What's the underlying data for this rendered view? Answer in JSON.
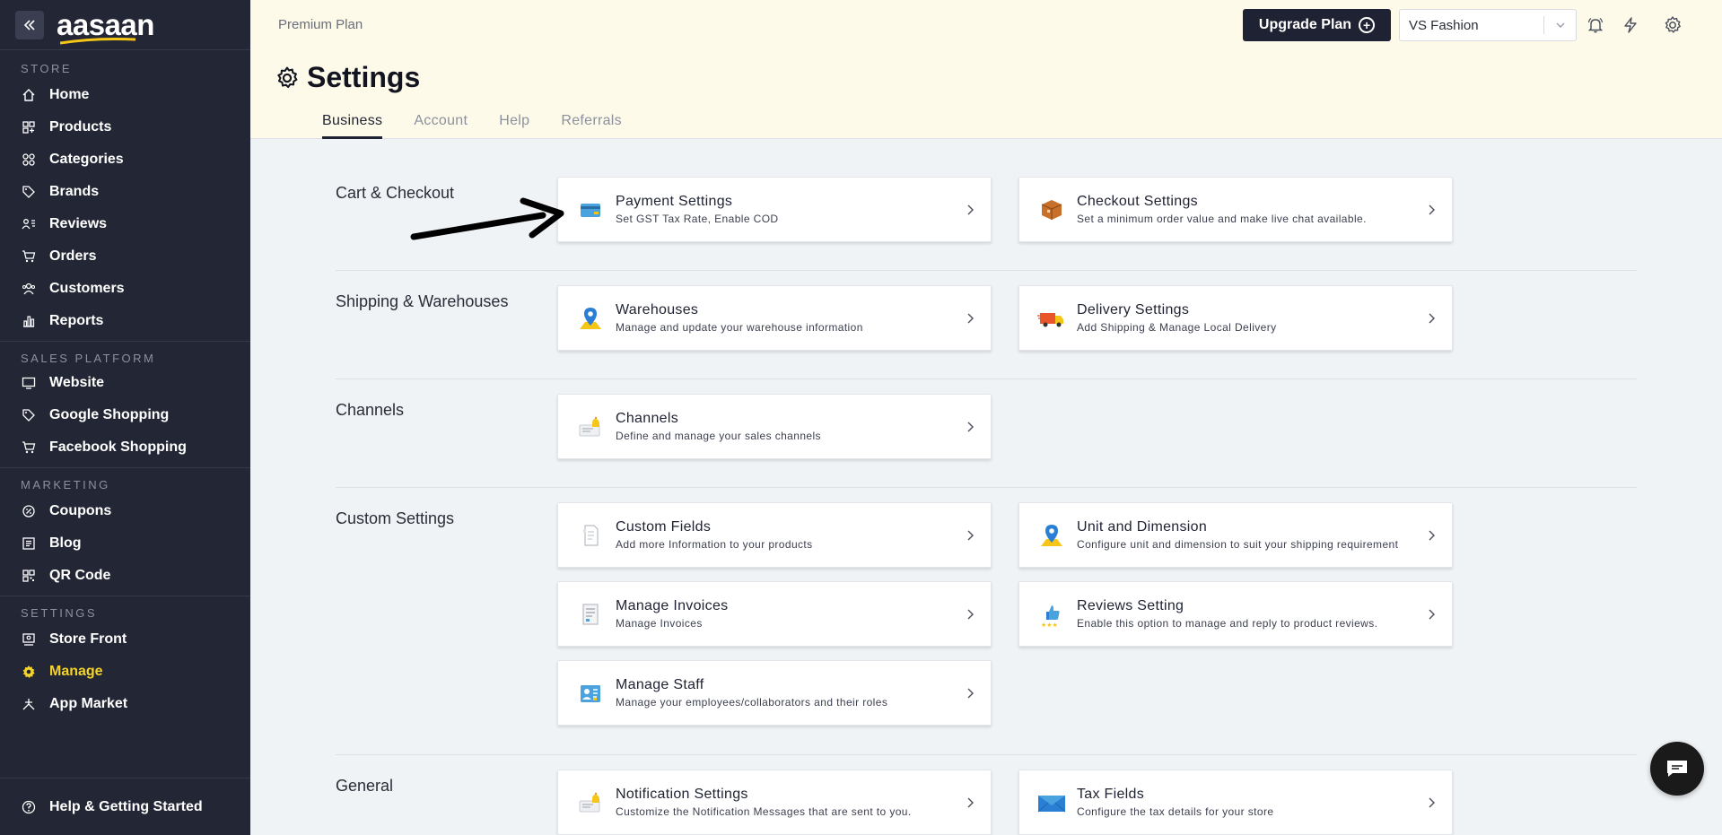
{
  "app": {
    "brand": "aasaan",
    "plan": "Premium Plan"
  },
  "sidebar": {
    "sections": [
      {
        "heading": "STORE",
        "items": [
          {
            "label": "Home",
            "icon": "home-icon"
          },
          {
            "label": "Products",
            "icon": "products-icon"
          },
          {
            "label": "Categories",
            "icon": "categories-icon"
          },
          {
            "label": "Brands",
            "icon": "tag-icon"
          },
          {
            "label": "Reviews",
            "icon": "reviews-icon"
          },
          {
            "label": "Orders",
            "icon": "cart-icon"
          },
          {
            "label": "Customers",
            "icon": "customers-icon"
          },
          {
            "label": "Reports",
            "icon": "bar-chart-icon"
          }
        ]
      },
      {
        "heading": "SALES PLATFORM",
        "items": [
          {
            "label": "Website",
            "icon": "monitor-icon"
          },
          {
            "label": "Google Shopping",
            "icon": "tag-icon"
          },
          {
            "label": "Facebook Shopping",
            "icon": "cart-icon"
          }
        ]
      },
      {
        "heading": "MARKETING",
        "items": [
          {
            "label": "Coupons",
            "icon": "coupon-icon"
          },
          {
            "label": "Blog",
            "icon": "blog-icon"
          },
          {
            "label": "QR Code",
            "icon": "qr-code-icon"
          }
        ]
      },
      {
        "heading": "SETTINGS",
        "items": [
          {
            "label": "Store Front",
            "icon": "storefront-icon"
          },
          {
            "label": "Manage",
            "icon": "gear-icon",
            "active": true
          },
          {
            "label": "App Market",
            "icon": "app-market-icon"
          }
        ]
      }
    ],
    "footer": {
      "label": "Help & Getting Started",
      "icon": "help-icon"
    },
    "active_color": "#f5d42a"
  },
  "header": {
    "upgrade_label": "Upgrade Plan",
    "store_selected": "VS Fashion",
    "page_title": "Settings",
    "tabs": [
      "Business",
      "Account",
      "Help",
      "Referrals"
    ],
    "active_tab": "Business"
  },
  "sections": [
    {
      "label": "Cart & Checkout"
    },
    {
      "label": "Shipping & Warehouses"
    },
    {
      "label": "Channels"
    },
    {
      "label": "Custom Settings"
    },
    {
      "label": "General"
    }
  ],
  "cards": [
    {
      "title": "Payment Settings",
      "desc": "Set GST Tax Rate, Enable COD",
      "icon": "credit-card-icon"
    },
    {
      "title": "Checkout Settings",
      "desc": "Set a minimum order value and make live chat available.",
      "icon": "package-icon"
    },
    {
      "title": "Warehouses",
      "desc": "Manage and update your warehouse information",
      "icon": "map-pin-icon"
    },
    {
      "title": "Delivery Settings",
      "desc": "Add Shipping & Manage Local Delivery",
      "icon": "delivery-truck-icon"
    },
    {
      "title": "Channels",
      "desc": "Define and manage your sales channels",
      "icon": "notification-card-icon"
    },
    {
      "title": "Custom Fields",
      "desc": "Add more Information to your products",
      "icon": "document-icon"
    },
    {
      "title": "Unit and Dimension",
      "desc": "Configure unit and dimension to suit your shipping requirement",
      "icon": "map-pin-icon"
    },
    {
      "title": "Manage Invoices",
      "desc": "Manage Invoices",
      "icon": "invoice-icon"
    },
    {
      "title": "Reviews Setting",
      "desc": "Enable this option to manage and reply to product reviews.",
      "icon": "thumbs-up-icon"
    },
    {
      "title": "Manage Staff",
      "desc": "Manage your employees/collaborators and their roles",
      "icon": "staff-icon"
    },
    {
      "title": "Notification Settings",
      "desc": "Customize the Notification Messages that are sent to you.",
      "icon": "notification-card-icon"
    },
    {
      "title": "Tax Fields",
      "desc": "Configure the tax details for your store",
      "icon": "envelope-icon"
    }
  ]
}
